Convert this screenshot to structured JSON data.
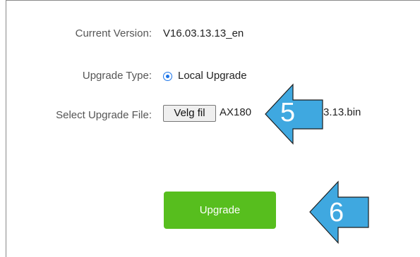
{
  "form": {
    "current_version_label": "Current Version:",
    "current_version_value": "V16.03.13.13_en",
    "upgrade_type_label": "Upgrade Type:",
    "upgrade_type_option": "Local Upgrade",
    "select_file_label": "Select Upgrade File:",
    "choose_file_button": "Velg fil",
    "file_name_part1": "AX180",
    "file_name_part2": "3.13.bin",
    "upgrade_button": "Upgrade"
  },
  "annotations": {
    "arrow_one_number": "5",
    "arrow_two_number": "6",
    "arrow_color": "#3fa8e0"
  },
  "colors": {
    "accent": "#1a73e8",
    "upgrade_button": "#57be1e"
  }
}
